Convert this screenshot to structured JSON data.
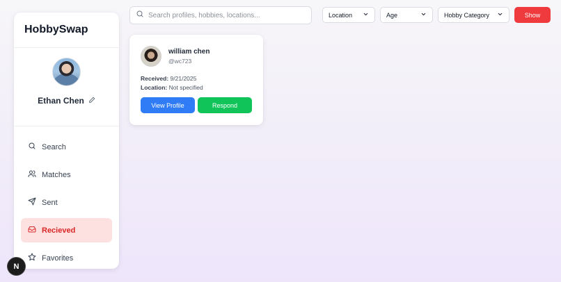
{
  "app": {
    "brand": "HobbySwap"
  },
  "profile": {
    "name": "Ethan Chen"
  },
  "nav": {
    "items": [
      {
        "label": "Search",
        "icon": "search-icon"
      },
      {
        "label": "Matches",
        "icon": "users-icon"
      },
      {
        "label": "Sent",
        "icon": "send-icon"
      },
      {
        "label": "Recieved",
        "icon": "inbox-icon",
        "active": true
      },
      {
        "label": "Favorites",
        "icon": "star-icon"
      }
    ]
  },
  "search": {
    "placeholder": "Search profiles, hobbies, locations...",
    "value": ""
  },
  "filters": {
    "location": "Location",
    "age": "Age",
    "hobby_category": "Hobby Category",
    "show_label": "Show"
  },
  "card": {
    "name": "william chen",
    "handle": "@wc723",
    "received_label": "Received:",
    "received_value": "9/21/2025",
    "location_label": "Location:",
    "location_value": "Not specified",
    "view_label": "View Profile",
    "respond_label": "Respond"
  },
  "badge": {
    "text": "N"
  },
  "colors": {
    "accent_red": "#ef3a3e",
    "active_bg": "#fde1e1",
    "view_blue": "#2f7cf6",
    "respond_green": "#10c45a"
  }
}
